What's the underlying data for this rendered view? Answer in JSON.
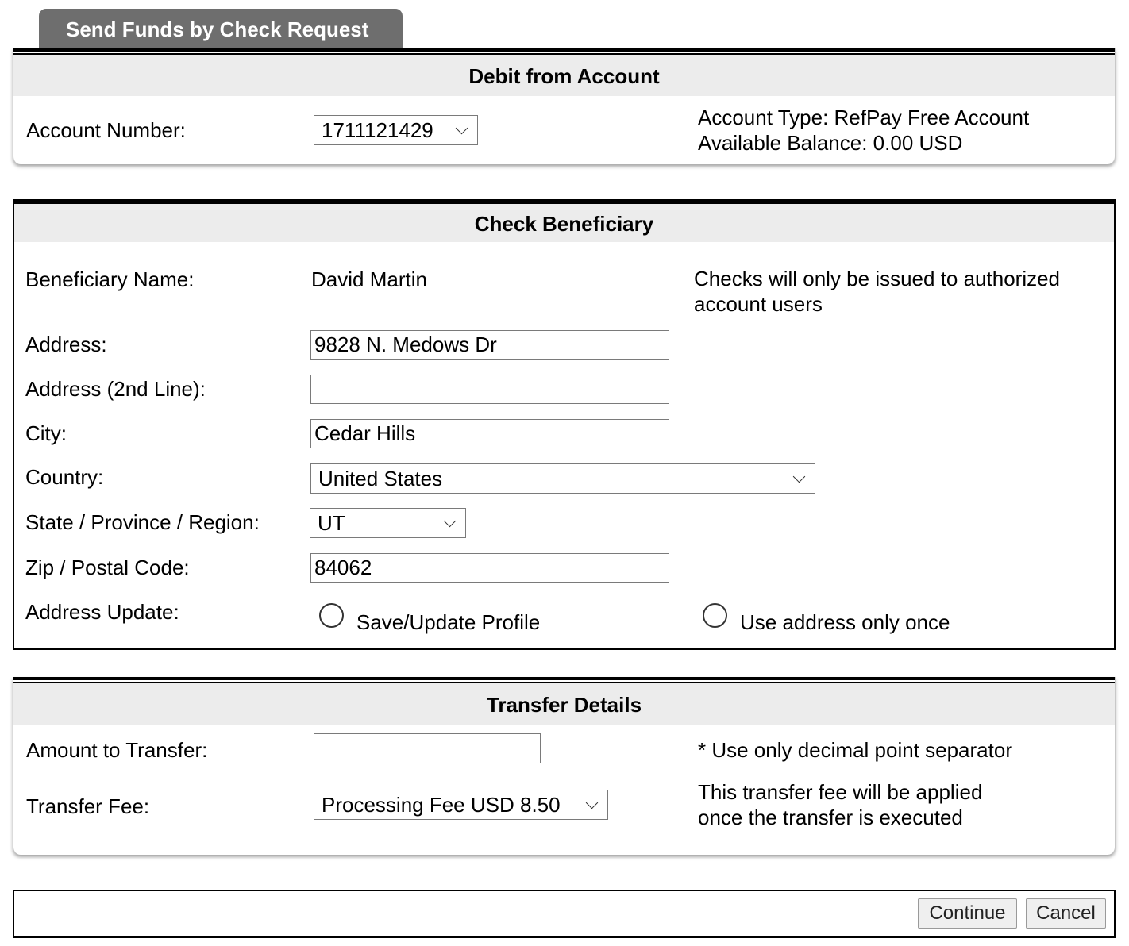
{
  "tab": {
    "title": "Send Funds by Check Request"
  },
  "debit": {
    "heading": "Debit from Account",
    "account_label": "Account Number:",
    "account_value": "1711121429",
    "account_type": "Account Type: RefPay Free Account",
    "balance": "Available Balance: 0.00 USD"
  },
  "beneficiary": {
    "heading": "Check Beneficiary",
    "name_label": "Beneficiary Name:",
    "name_value": "David Martin",
    "note_line1": "Checks will only be issued to authorized",
    "note_line2": "account users",
    "address_label": "Address:",
    "address_value": "9828 N. Medows Dr",
    "address2_label": "Address (2nd Line):",
    "address2_value": "",
    "city_label": "City:",
    "city_value": "Cedar Hills",
    "country_label": "Country:",
    "country_value": "United States",
    "state_label": "State / Province / Region:",
    "state_value": "UT",
    "zip_label": "Zip / Postal Code:",
    "zip_value": "84062",
    "update_label": "Address Update:",
    "option_save": "Save/Update Profile",
    "option_once": "Use address only once"
  },
  "transfer": {
    "heading": "Transfer Details",
    "amount_label": "Amount to Transfer:",
    "amount_value": "",
    "amount_note": "* Use only decimal point separator",
    "fee_label": "Transfer Fee:",
    "fee_value": "Processing Fee USD 8.50",
    "fee_note_line1": "This transfer fee will be applied",
    "fee_note_line2": "once the transfer is executed"
  },
  "actions": {
    "continue_label": "Continue",
    "cancel_label": "Cancel"
  }
}
